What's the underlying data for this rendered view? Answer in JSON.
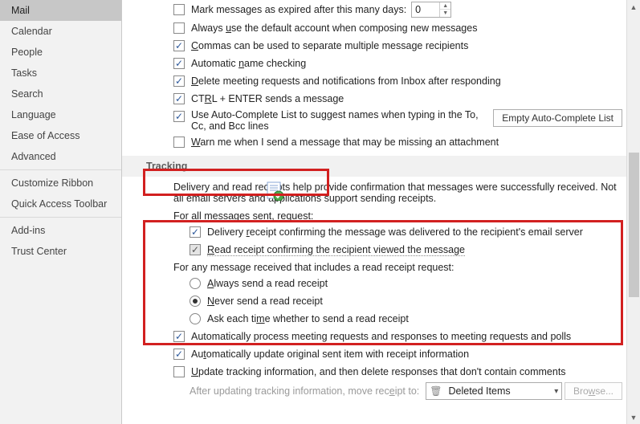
{
  "sidebar": {
    "items": [
      "Mail",
      "Calendar",
      "People",
      "Tasks",
      "Search",
      "Language",
      "Ease of Access",
      "Advanced",
      "Customize Ribbon",
      "Quick Access Toolbar",
      "Add-ins",
      "Trust Center"
    ]
  },
  "send": {
    "mark_expired_label": "Mark messages as expired after this many days:",
    "mark_expired_value": "0",
    "default_account": "Always use the default account when composing new messages",
    "commas": "Commas can be used to separate multiple message recipients",
    "auto_name": "Automatic name checking",
    "delete_meeting": "Delete meeting requests and notifications from Inbox after responding",
    "ctrl_enter": "CTRL + ENTER sends a message",
    "autocomplete": "Use Auto-Complete List to suggest names when typing in the To, Cc, and Bcc lines",
    "empty_btn": "Empty Auto-Complete List",
    "warn_attach": "Warn me when I send a message that may be missing an attachment"
  },
  "tracking": {
    "header": "Tracking",
    "desc": "Delivery and read receipts help provide confirmation that messages were successfully received. Not all email servers and applications support sending receipts.",
    "for_all": "For all messages sent, request:",
    "delivery_receipt": "Delivery receipt confirming the message was delivered to the recipient's email server",
    "read_receipt": "Read receipt confirming the recipient viewed the message",
    "for_any": "For any message received that includes a read receipt request:",
    "r_always": "Always send a read receipt",
    "r_never": "Never send a read receipt",
    "r_ask": "Ask each time whether to send a read receipt",
    "auto_process": "Automatically process meeting requests and responses to meeting requests and polls",
    "auto_update": "Automatically update original sent item with receipt information",
    "update_track": "Update tracking information, and then delete responses that don't contain comments",
    "after_update": "After updating tracking information, move receipt to:",
    "folder": "Deleted Items",
    "browse": "Browse..."
  }
}
